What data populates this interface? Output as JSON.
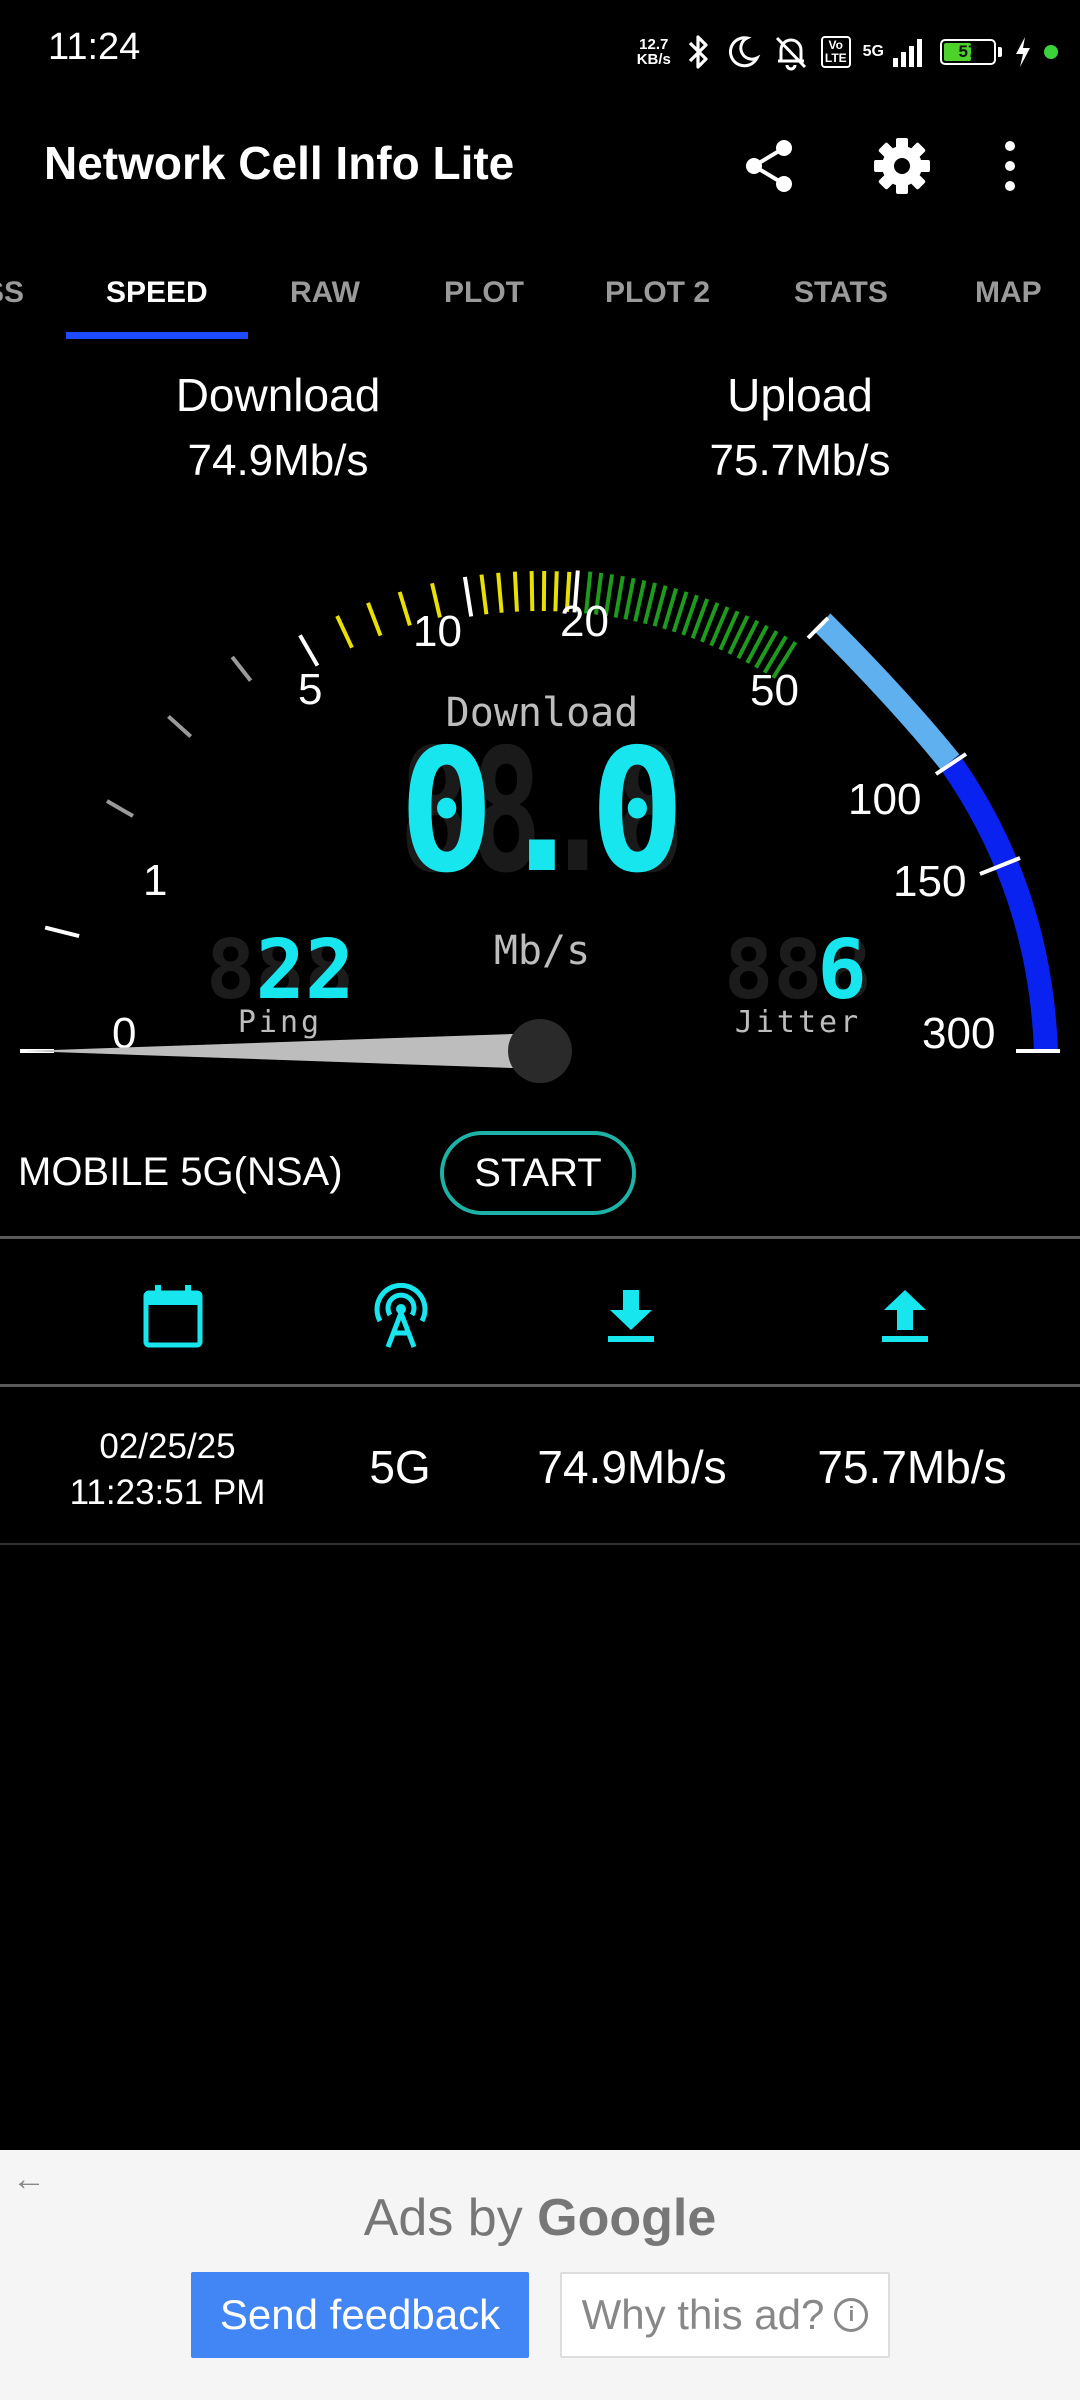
{
  "status_bar": {
    "time": "11:24",
    "net_speed": "12.7",
    "net_speed_unit": "KB/s",
    "volte_top": "Vo",
    "volte_bottom": "LTE",
    "network": "5G",
    "battery": "57",
    "battery_level": 0.57,
    "icons": [
      "bluetooth-icon",
      "moon-icon",
      "bell-off-icon",
      "volte-icon",
      "signal-icon",
      "battery-icon",
      "charging-icon"
    ]
  },
  "app_bar": {
    "title": "Network Cell Info Lite",
    "actions": [
      "share-icon",
      "gear-icon",
      "more-vert-icon"
    ]
  },
  "tabs": [
    {
      "label": "SS",
      "active": false
    },
    {
      "label": "SPEED",
      "active": true
    },
    {
      "label": "RAW",
      "active": false
    },
    {
      "label": "PLOT",
      "active": false
    },
    {
      "label": "PLOT 2",
      "active": false
    },
    {
      "label": "STATS",
      "active": false
    },
    {
      "label": "MAP",
      "active": false
    }
  ],
  "summary": {
    "download_label": "Download",
    "download_value": "74.9Mb/s",
    "upload_label": "Upload",
    "upload_value": "75.7Mb/s"
  },
  "gauge": {
    "scale_labels": [
      "0",
      "1",
      "5",
      "10",
      "20",
      "50",
      "100",
      "150",
      "300"
    ],
    "mode_label": "Download",
    "display_value": "0.0",
    "unit": "Mb/s",
    "ping_value": "22",
    "ping_label": "Ping",
    "jitter_value": "6",
    "jitter_label": "Jitter",
    "needle_value": 0,
    "colors": {
      "yellow": "#e8e000",
      "green": "#1e9a1e",
      "light_blue": "#5fb0ee",
      "blue": "#0a22f0",
      "digits": "#18e6ef"
    }
  },
  "connection": {
    "type": "MOBILE 5G(NSA)",
    "start_label": "START"
  },
  "history": {
    "header_icons": [
      "calendar-icon",
      "antenna-icon",
      "download-icon",
      "upload-icon"
    ],
    "rows": [
      {
        "date": "02/25/25",
        "time": "11:23:51 PM",
        "network": "5G",
        "download": "74.9Mb/s",
        "upload": "75.7Mb/s"
      }
    ]
  },
  "ad": {
    "ads_by": "Ads by",
    "brand": "Google",
    "send_feedback": "Send feedback",
    "why_this_ad": "Why this ad?"
  }
}
